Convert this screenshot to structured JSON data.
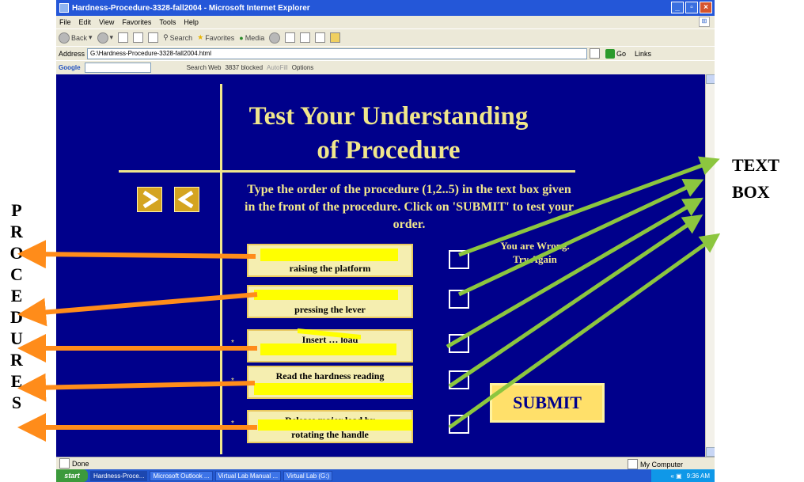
{
  "window": {
    "title": "Hardness-Procedure-3328-fall2004 - Microsoft Internet Explorer",
    "controls": [
      "_",
      "▫",
      "×"
    ]
  },
  "menu": [
    "File",
    "Edit",
    "View",
    "Favorites",
    "Tools",
    "Help"
  ],
  "toolbar": {
    "back": "Back",
    "search": "Search",
    "favorites": "Favorites",
    "media": "Media"
  },
  "address": {
    "label": "Address",
    "url": "G:\\Hardness-Procedure-3328-fall2004.html",
    "go": "Go",
    "links": "Links"
  },
  "google_bar": {
    "logo": "Google",
    "search_web": "Search Web",
    "blocked": "3837 blocked",
    "autofill": "AutoFill",
    "options": "Options"
  },
  "page": {
    "title_line1": "Test Your Understanding",
    "title_line2": "of Procedure",
    "instruction": "Type the order of the procedure (1,2..5) in the text box given in the front of the procedure. Click on 'SUBMIT' to test your order.",
    "feedback_line1": "You are Wrong.",
    "feedback_line2": "Try Again",
    "submit_label": "SUBMIT",
    "steps": [
      {
        "line1": "",
        "line2": "raising the platform"
      },
      {
        "line1": "",
        "line2": "pressing the lever"
      },
      {
        "line1": "Insert … load",
        "line2": ""
      },
      {
        "line1": "Read the hardness reading",
        "line2": ""
      },
      {
        "line1": "Release major load by",
        "line2": "rotating the handle"
      }
    ]
  },
  "status": {
    "left": "Done",
    "right": "My Computer"
  },
  "taskbar": {
    "start": "start",
    "tasks": [
      "Hardness-Proce...",
      "Microsoft Outlook ...",
      "Virtual Lab Manual ...",
      "Virtual Lab (G:)"
    ],
    "clock": "9:36 AM"
  },
  "annotations": {
    "procedures_letters": [
      "P",
      "R",
      "O",
      "C",
      "E",
      "D",
      "U",
      "R",
      "E",
      "S"
    ],
    "textbox_line1": "TEXT",
    "textbox_line2": "BOX",
    "arrow_colors": {
      "procedures": "#ff8c1a",
      "textbox": "#8cc63f"
    }
  },
  "colors": {
    "page_bg": "#00008b",
    "accent": "#f0e68c",
    "highlight": "#ffff00"
  }
}
